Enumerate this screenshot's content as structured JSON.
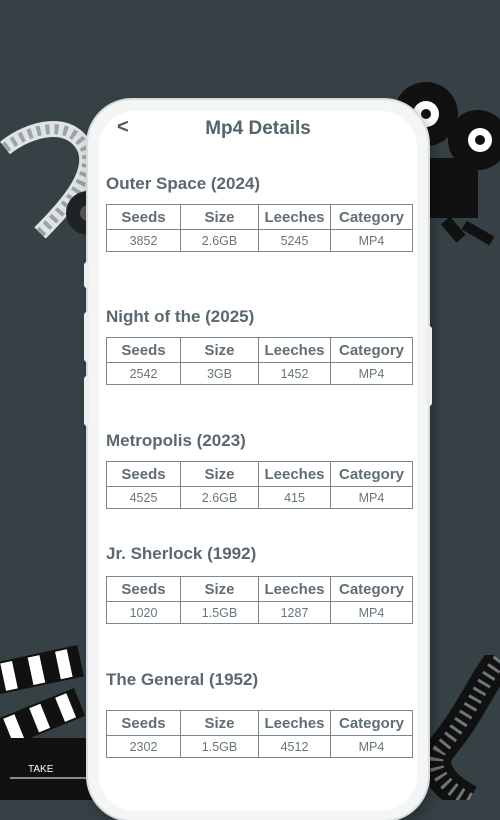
{
  "header": {
    "back_icon": "<",
    "title": "Mp4 Details"
  },
  "columns": [
    "Seeds",
    "Size",
    "Leeches",
    "Category"
  ],
  "movies": [
    {
      "title": "Outer Space (2024)",
      "seeds": "3852",
      "size": "2.6GB",
      "leeches": "5245",
      "category": "MP4"
    },
    {
      "title": "Night of the (2025)",
      "seeds": "2542",
      "size": "3GB",
      "leeches": "1452",
      "category": "MP4"
    },
    {
      "title": "Metropolis (2023)",
      "seeds": "4525",
      "size": "2.6GB",
      "leeches": "415",
      "category": "MP4"
    },
    {
      "title": "Jr. Sherlock (1992)",
      "seeds": "1020",
      "size": "1.5GB",
      "leeches": "1287",
      "category": "MP4"
    },
    {
      "title": "The General (1952)",
      "seeds": "2302",
      "size": "1.5GB",
      "leeches": "4512",
      "category": "MP4"
    }
  ],
  "decor": {
    "clapperboard_label": "TAKE"
  },
  "colors": {
    "background": "#364146",
    "screen": "#ffffff",
    "text": "#5a6870",
    "border": "#7b878d"
  }
}
